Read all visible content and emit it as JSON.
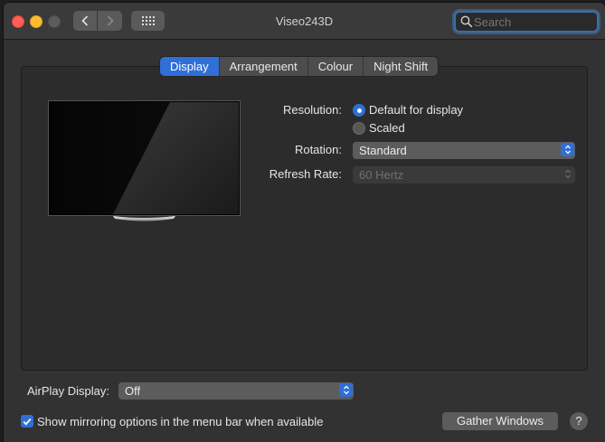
{
  "window": {
    "title": "Viseo243D"
  },
  "search": {
    "placeholder": "Search",
    "value": ""
  },
  "tabs": [
    {
      "label": "Display",
      "active": true
    },
    {
      "label": "Arrangement",
      "active": false
    },
    {
      "label": "Colour",
      "active": false
    },
    {
      "label": "Night Shift",
      "active": false
    }
  ],
  "resolution": {
    "label": "Resolution:",
    "options": [
      {
        "label": "Default for display",
        "selected": true
      },
      {
        "label": "Scaled",
        "selected": false
      }
    ]
  },
  "rotation": {
    "label": "Rotation:",
    "value": "Standard"
  },
  "refresh_rate": {
    "label": "Refresh Rate:",
    "value": "60 Hertz",
    "enabled": false
  },
  "airplay": {
    "label": "AirPlay Display:",
    "value": "Off"
  },
  "mirroring": {
    "label": "Show mirroring options in the menu bar when available",
    "checked": true
  },
  "gather_button": {
    "label": "Gather Windows"
  },
  "help_button": {
    "label": "?"
  },
  "colors": {
    "accent": "#2f6fd6",
    "close": "#ff5f57",
    "minimize": "#febc2e",
    "window_bg": "#323232"
  },
  "icons": [
    "back-chevron-icon",
    "forward-chevron-icon",
    "grid-icon",
    "search-icon",
    "monitor-icon",
    "up-down-chevron-icon",
    "checkmark-icon"
  ]
}
